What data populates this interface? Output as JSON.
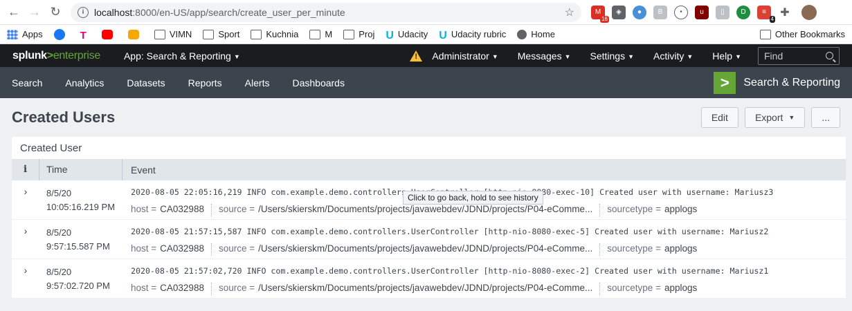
{
  "browser": {
    "url_host": "localhost",
    "url_path": ":8000/en-US/app/search/create_user_per_minute",
    "gmail_badge": "16",
    "todoist_badge": "4"
  },
  "bookmarks": {
    "items": [
      "Apps",
      "VIMN",
      "Sport",
      "Kuchnia",
      "M",
      "Proj",
      "Udacity",
      "Udacity rubric",
      "Home"
    ],
    "other": "Other Bookmarks"
  },
  "splunk": {
    "logo_a": "splunk",
    "logo_gt": ">",
    "logo_b": "enterprise",
    "app_menu": "App: Search & Reporting",
    "user_menu": "Administrator",
    "messages": "Messages",
    "settings": "Settings",
    "activity": "Activity",
    "help": "Help",
    "find_placeholder": "Find",
    "nav": [
      "Search",
      "Analytics",
      "Datasets",
      "Reports",
      "Alerts",
      "Dashboards"
    ],
    "app_brand": "Search & Reporting"
  },
  "page": {
    "title": "Created Users",
    "edit": "Edit",
    "export": "Export",
    "more": "..."
  },
  "panel": {
    "title": "Created User",
    "col_info": "i",
    "col_time": "Time",
    "col_event": "Event",
    "field_host": "host =",
    "field_source": "source =",
    "field_sourcetype": "sourcetype =",
    "rows": [
      {
        "date": "8/5/20",
        "time": "10:05:16.219 PM",
        "raw": "2020-08-05 22:05:16,219 INFO com.example.demo.controllers.UserController [http-nio-8080-exec-10] Created user with username: Mariusz3",
        "host": "CA032988",
        "source": "/Users/skierskm/Documents/projects/javawebdev/JDND/projects/P04-eComme...",
        "sourcetype": "applogs"
      },
      {
        "date": "8/5/20",
        "time": "9:57:15.587 PM",
        "raw": "2020-08-05 21:57:15,587 INFO com.example.demo.controllers.UserController [http-nio-8080-exec-5] Created user with username: Mariusz2",
        "host": "CA032988",
        "source": "/Users/skierskm/Documents/projects/javawebdev/JDND/projects/P04-eComme...",
        "sourcetype": "applogs"
      },
      {
        "date": "8/5/20",
        "time": "9:57:02.720 PM",
        "raw": "2020-08-05 21:57:02,720 INFO com.example.demo.controllers.UserController [http-nio-8080-exec-2] Created user with username: Mariusz1",
        "host": "CA032988",
        "source": "/Users/skierskm/Documents/projects/javawebdev/JDND/projects/P04-eComme...",
        "sourcetype": "applogs"
      }
    ]
  },
  "tooltip": "Click to go back, hold to see history"
}
